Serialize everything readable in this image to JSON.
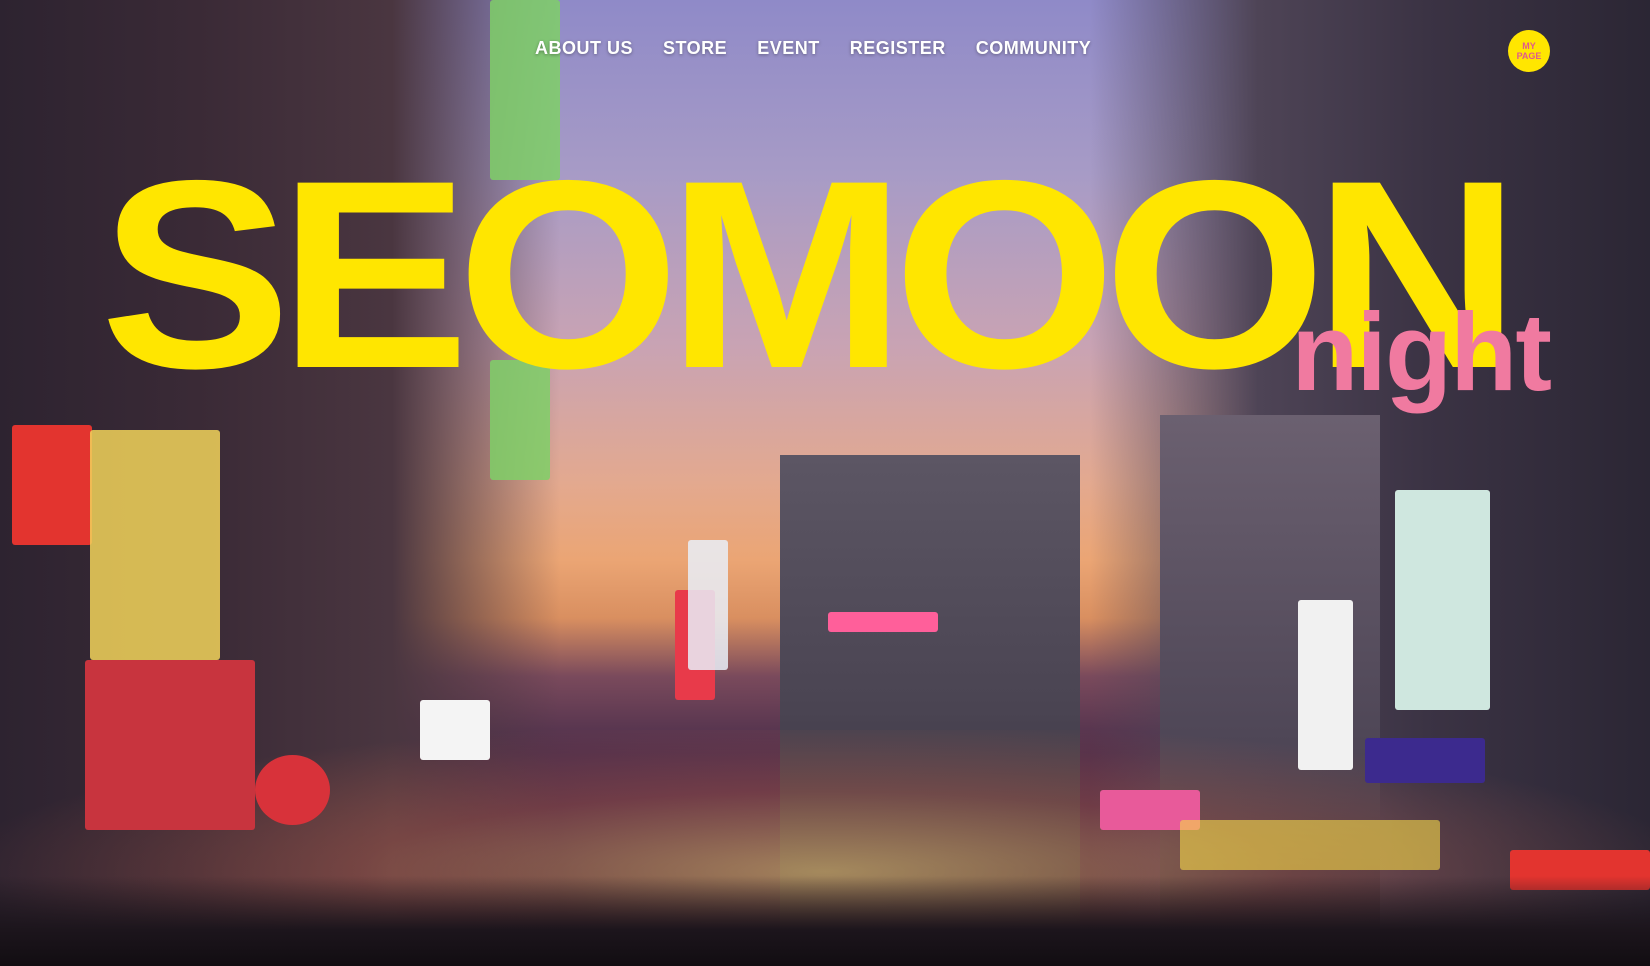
{
  "nav": {
    "items": [
      {
        "label": "ABOUT US"
      },
      {
        "label": "STORE"
      },
      {
        "label": "EVENT"
      },
      {
        "label": "REGISTER"
      },
      {
        "label": "COMMUNITY"
      }
    ],
    "mypage_label": "MY PAGE"
  },
  "hero": {
    "title": "SEOMOON",
    "subtitle": "night",
    "background": "night-street-photo"
  },
  "colors": {
    "title": "#ffe600",
    "subtitle": "#f07aa0",
    "mypage_bg": "#ffe600",
    "mypage_text": "#e05a8c"
  }
}
